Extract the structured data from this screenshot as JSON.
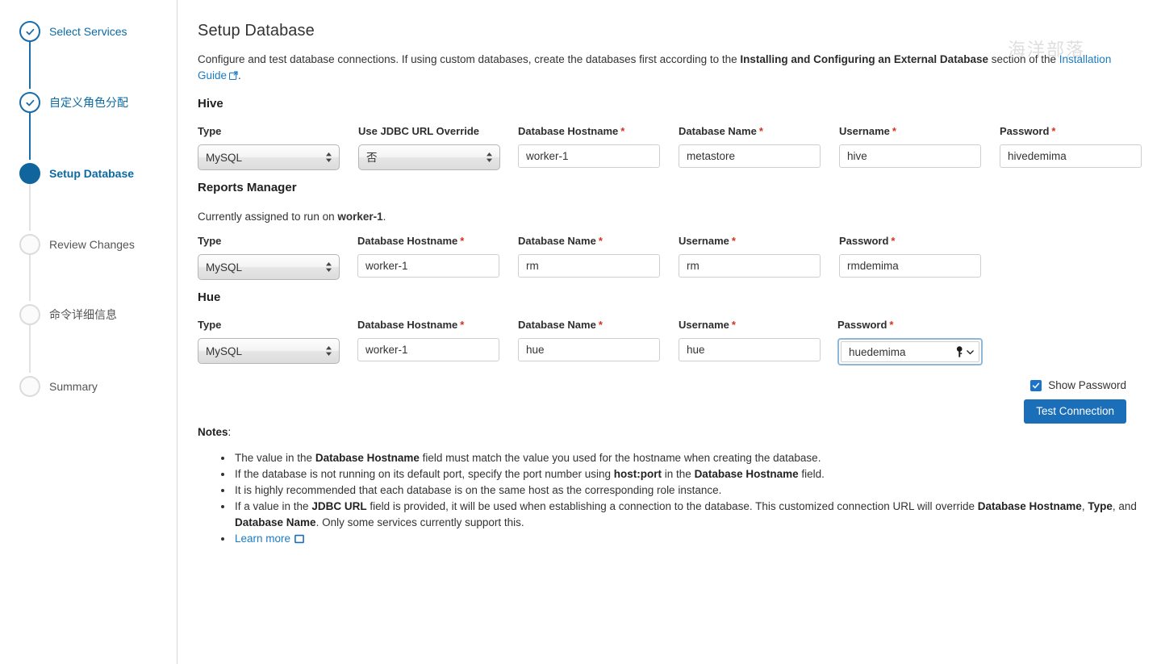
{
  "sidebar": {
    "steps": [
      {
        "label": "Select Services",
        "state": "done"
      },
      {
        "label": "自定义角色分配",
        "state": "done"
      },
      {
        "label": "Setup Database",
        "state": "active"
      },
      {
        "label": "Review Changes",
        "state": "todo"
      },
      {
        "label": "命令详细信息",
        "state": "todo"
      },
      {
        "label": "Summary",
        "state": "todo"
      }
    ]
  },
  "page": {
    "title": "Setup Database",
    "intro_a": "Configure and test database connections. If using custom databases, create the databases first according to the ",
    "intro_bold": "Installing and Configuring an External Database",
    "intro_b": " section of the ",
    "intro_link": "Installation Guide",
    "intro_c": "."
  },
  "hive": {
    "heading": "Hive",
    "type_label": "Type",
    "type_value": "MySQL",
    "jdbc_label": "Use JDBC URL Override",
    "jdbc_value": "否",
    "hostname_label": "Database Hostname",
    "hostname_value": "worker-1",
    "dbname_label": "Database Name",
    "dbname_value": "metastore",
    "username_label": "Username",
    "username_value": "hive",
    "password_label": "Password",
    "password_value": "hivedemima"
  },
  "reports_manager": {
    "heading": "Reports Manager",
    "assigned_prefix": "Currently assigned to run on ",
    "assigned_host": "worker-1",
    "assigned_suffix": ".",
    "type_label": "Type",
    "type_value": "MySQL",
    "hostname_label": "Database Hostname",
    "hostname_value": "worker-1",
    "dbname_label": "Database Name",
    "dbname_value": "rm",
    "username_label": "Username",
    "username_value": "rm",
    "password_label": "Password",
    "password_value": "rmdemima"
  },
  "hue": {
    "heading": "Hue",
    "type_label": "Type",
    "type_value": "MySQL",
    "hostname_label": "Database Hostname",
    "hostname_value": "worker-1",
    "dbname_label": "Database Name",
    "dbname_value": "hue",
    "username_label": "Username",
    "username_value": "hue",
    "password_label": "Password",
    "password_value": "huedemima"
  },
  "actions": {
    "show_password_label": "Show Password",
    "show_password_checked": true,
    "test_connection_label": "Test Connection"
  },
  "notes": {
    "title": "Notes",
    "title_colon": ":",
    "items": [
      {
        "parts": [
          {
            "t": "The value in the ",
            "b": false
          },
          {
            "t": "Database Hostname",
            "b": true
          },
          {
            "t": " field must match the value you used for the hostname when creating the database.",
            "b": false
          }
        ]
      },
      {
        "parts": [
          {
            "t": "If the database is not running on its default port, specify the port number using ",
            "b": false
          },
          {
            "t": "host:port",
            "b": true
          },
          {
            "t": " in the ",
            "b": false
          },
          {
            "t": "Database Hostname",
            "b": true
          },
          {
            "t": " field.",
            "b": false
          }
        ]
      },
      {
        "parts": [
          {
            "t": "It is highly recommended that each database is on the same host as the corresponding role instance.",
            "b": false
          }
        ]
      },
      {
        "parts": [
          {
            "t": "If a value in the ",
            "b": false
          },
          {
            "t": "JDBC URL",
            "b": true
          },
          {
            "t": " field is provided, it will be used when establishing a connection to the database. This customized connection URL will override ",
            "b": false
          },
          {
            "t": "Database Hostname",
            "b": true
          },
          {
            "t": ", ",
            "b": false
          },
          {
            "t": "Type",
            "b": true
          },
          {
            "t": ", and ",
            "b": false
          },
          {
            "t": "Database Name",
            "b": true
          },
          {
            "t": ". Only some services currently support this.",
            "b": false
          }
        ]
      }
    ],
    "learn_more": "Learn more"
  },
  "watermark": "海洋部落",
  "colors": {
    "accent": "#1a6fb8",
    "link": "#1a7bc4",
    "required": "#d9301a",
    "step_done": "#1b6ca8",
    "step_active": "#10659c",
    "focus_ring": "#8fb8d6"
  },
  "icons": {
    "external_link": "external-link-icon",
    "box": "box-icon",
    "key": "key-icon",
    "check": "check-icon"
  }
}
